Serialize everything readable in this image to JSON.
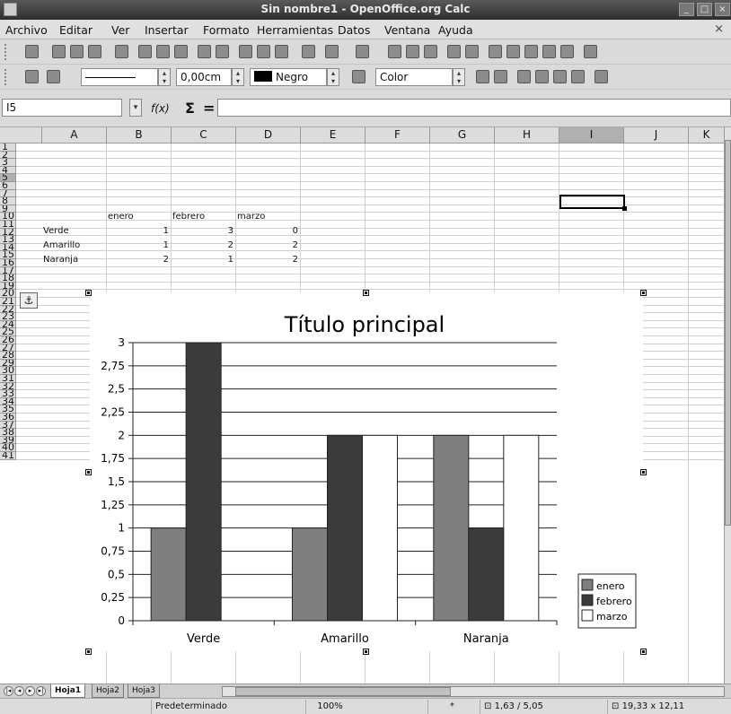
{
  "window": {
    "title": "Sin nombre1 - OpenOffice.org Calc"
  },
  "menu": [
    "Archivo",
    "Editar",
    "Ver",
    "Insertar",
    "Formato",
    "Herramientas",
    "Datos",
    "Ventana",
    "Ayuda"
  ],
  "format_toolbar": {
    "line_width_value": "0,00cm",
    "color_name": "Negro",
    "area_fill": "Color"
  },
  "formula_bar": {
    "cell_ref": "I5",
    "function_glyph": "f(x)",
    "sum_glyph": "Σ",
    "equals_glyph": "=",
    "formula": ""
  },
  "sheet": {
    "columns": [
      "A",
      "B",
      "C",
      "D",
      "E",
      "F",
      "G",
      "H",
      "I",
      "J",
      "K"
    ],
    "selected_column": "I",
    "rows": [
      "1",
      "2",
      "3",
      "4",
      "5",
      "6",
      "7",
      "8",
      "9",
      "10",
      "11",
      "12",
      "13",
      "14",
      "15",
      "16",
      "17",
      "18",
      "19",
      "20",
      "21",
      "22",
      "23",
      "24",
      "25",
      "26",
      "27",
      "28",
      "29",
      "30",
      "31",
      "32",
      "33",
      "34",
      "35",
      "36",
      "37",
      "38",
      "39",
      "40",
      "41"
    ],
    "selected_row": "5",
    "cells": {
      "header_row": {
        "B": "enero",
        "C": "febrero",
        "D": "marzo"
      },
      "data_rows": [
        {
          "A": "Verde",
          "B": "1",
          "C": "3",
          "D": "0"
        },
        {
          "A": "Amarillo",
          "B": "1",
          "C": "2",
          "D": "2"
        },
        {
          "A": "Naranja",
          "B": "2",
          "C": "1",
          "D": "2"
        }
      ]
    }
  },
  "chart_data": {
    "type": "bar",
    "title": "Título principal",
    "categories": [
      "Verde",
      "Amarillo",
      "Naranja"
    ],
    "series": [
      {
        "name": "enero",
        "values": [
          1,
          1,
          2
        ],
        "color": "#7f7f7f"
      },
      {
        "name": "febrero",
        "values": [
          3,
          2,
          1
        ],
        "color": "#3b3b3b"
      },
      {
        "name": "marzo",
        "values": [
          0,
          2,
          2
        ],
        "color": "#ffffff"
      }
    ],
    "yticks": [
      "0",
      "0,25",
      "0,5",
      "0,75",
      "1",
      "1,25",
      "1,5",
      "1,75",
      "2",
      "2,25",
      "2,5",
      "2,75",
      "3"
    ],
    "ylim": [
      0,
      3
    ],
    "grid": true,
    "legend_position": "right"
  },
  "sheet_tabs": [
    "Hoja1",
    "Hoja2",
    "Hoja3"
  ],
  "active_tab": "Hoja1",
  "status": {
    "page_style": "Predeterminado",
    "zoom": "100%",
    "insert_mode": "*",
    "position": "1,63 / 5,05",
    "size": "19,33 x 12,11"
  }
}
